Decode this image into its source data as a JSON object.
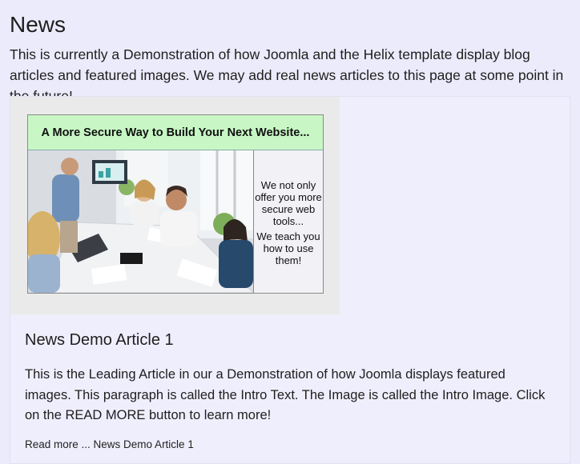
{
  "page": {
    "title": "News",
    "intro": "This is currently a Demonstration of how Joomla and the Helix template display blog articles and featured images. We may add real news articles to this page at some point in the future!"
  },
  "article": {
    "image": {
      "banner": "A More Secure Way to Build Your Next Website...",
      "side_text_1": "We not only offer you more secure web tools...",
      "side_text_2": "We teach you how to use them!"
    },
    "title": "News Demo Article 1",
    "intro": "This is the Leading Article in our a Demonstration of how Joomla displays featured images. This paragraph is called the Intro Text. The Image is called the Intro Image. Click on the READ MORE button to learn more!",
    "read_more": "Read more ... News Demo Article 1"
  }
}
